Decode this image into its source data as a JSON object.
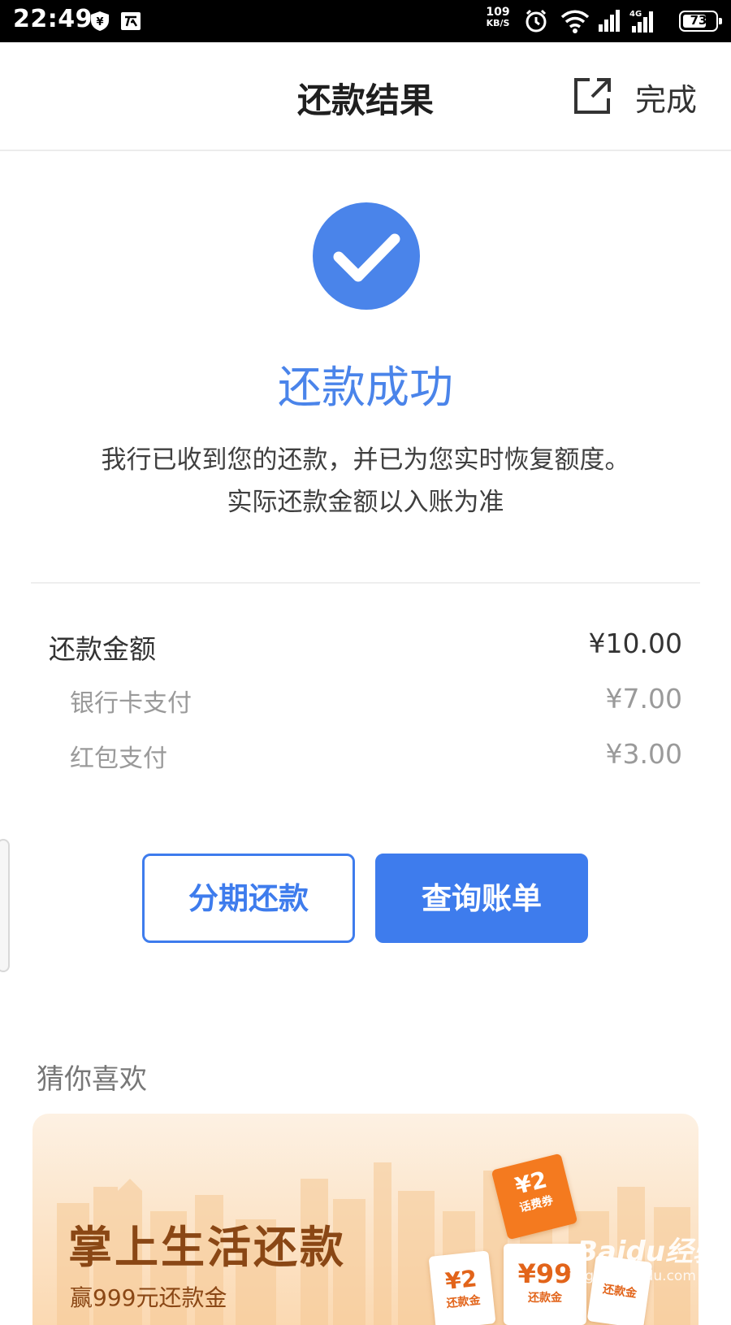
{
  "status_bar": {
    "time": "22:49",
    "net_speed_value": "109",
    "net_speed_unit": "KB/S",
    "network_type": "4G",
    "battery": "73",
    "battery_level": 0.73
  },
  "header": {
    "title": "还款结果",
    "done_label": "完成"
  },
  "result": {
    "title": "还款成功",
    "desc_line1": "我行已收到您的还款，并已为您实时恢复额度。",
    "desc_line2": "实际还款金额以入账为准"
  },
  "amounts": {
    "total_label": "还款金额",
    "total_value": "¥10.00",
    "items": [
      {
        "label": "银行卡支付",
        "value": "¥7.00"
      },
      {
        "label": "红包支付",
        "value": "¥3.00"
      }
    ]
  },
  "actions": {
    "installment_label": "分期还款",
    "query_bill_label": "查询账单"
  },
  "recommend": {
    "title": "猜你喜欢",
    "banner": {
      "title": "掌上生活还款",
      "subtitle": "赢999元还款金",
      "coupons": [
        {
          "amount": "¥2",
          "label": "话费券"
        },
        {
          "amount": "¥2",
          "label": "还款金"
        },
        {
          "amount": "¥99",
          "label": "还款金"
        },
        {
          "amount": "",
          "label": "还款金"
        }
      ]
    }
  },
  "watermark": {
    "brand": "Baidu经验",
    "url": "jingyan.baidu.com"
  },
  "colors": {
    "accent": "#3e7ced",
    "success_icon": "#4a84ea",
    "banner_text": "#8a4715"
  }
}
